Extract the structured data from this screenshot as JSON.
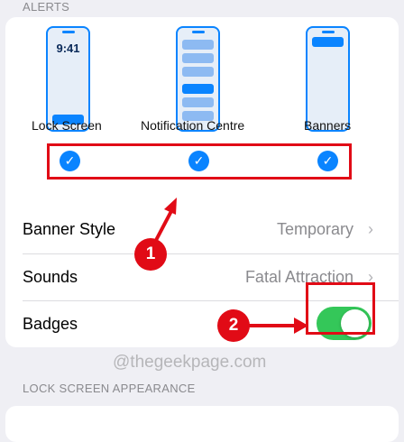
{
  "section_headers": {
    "alerts": "ALERTS",
    "lock_screen_appearance": "LOCK SCREEN APPEARANCE"
  },
  "alert_styles": [
    {
      "label": "Lock Screen",
      "preview_time": "9:41",
      "checked": true
    },
    {
      "label": "Notification Centre",
      "checked": true
    },
    {
      "label": "Banners",
      "checked": true
    }
  ],
  "rows": {
    "banner_style": {
      "title": "Banner Style",
      "value": "Temporary"
    },
    "sounds": {
      "title": "Sounds",
      "value": "Fatal Attraction"
    },
    "badges": {
      "title": "Badges",
      "enabled": true
    }
  },
  "annotations": {
    "step1": "1",
    "step2": "2"
  },
  "watermark": "@thegeekpage.com",
  "colors": {
    "accent_blue": "#0a84ff",
    "toggle_on": "#34c759",
    "annotation_red": "#e10b16"
  },
  "icons": {
    "checkmark": "checkmark-icon",
    "chevron": "chevron-right-icon"
  }
}
